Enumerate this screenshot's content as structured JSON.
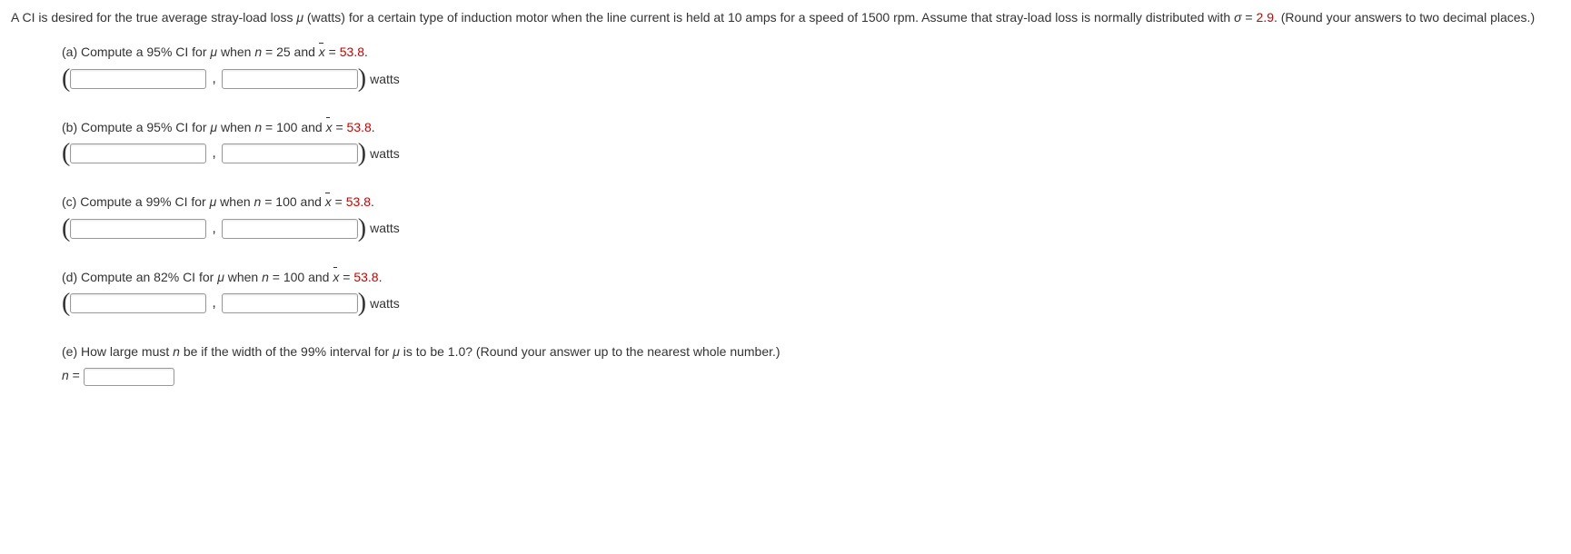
{
  "intro": {
    "pre": "A CI is desired for the true average stray-load loss ",
    "mu": "μ",
    "mid1": " (watts) for a certain type of induction motor when the line current is held at 10 amps for a speed of 1500 rpm. Assume that stray-load loss is normally distributed with ",
    "sigma": "σ",
    "eq": " = ",
    "sigma_val": "2.9",
    "after": ". (Round your answers to two decimal places.)"
  },
  "parts": {
    "a": {
      "label": "(a) Compute a 95% CI for ",
      "mu": "μ",
      "when": " when ",
      "n": "n",
      "nval": " = 25 and ",
      "x": "x",
      "xeq": " = ",
      "xval": "53.8",
      "dot": ".",
      "unit": "watts"
    },
    "b": {
      "label": "(b) Compute a 95% CI for ",
      "mu": "μ",
      "when": " when ",
      "n": "n",
      "nval": " = 100 and ",
      "x": "x",
      "xeq": " = ",
      "xval": "53.8",
      "dot": ".",
      "unit": "watts"
    },
    "c": {
      "label": "(c) Compute a 99% CI for ",
      "mu": "μ",
      "when": " when ",
      "n": "n",
      "nval": " = 100 and ",
      "x": "x",
      "xeq": " = ",
      "xval": "53.8",
      "dot": ".",
      "unit": "watts"
    },
    "d": {
      "label": "(d) Compute an 82% CI for ",
      "mu": "μ",
      "when": " when ",
      "n": "n",
      "nval": " = 100 and ",
      "x": "x",
      "xeq": " = ",
      "xval": "53.8",
      "dot": ".",
      "unit": "watts"
    },
    "e": {
      "label1": "(e) How large must ",
      "n": "n",
      "label2": " be if the width of the 99% interval for ",
      "mu": "μ",
      "label3": " is to be 1.0? (Round your answer up to the nearest whole number.)",
      "nline": "n",
      "neq": " = "
    }
  }
}
